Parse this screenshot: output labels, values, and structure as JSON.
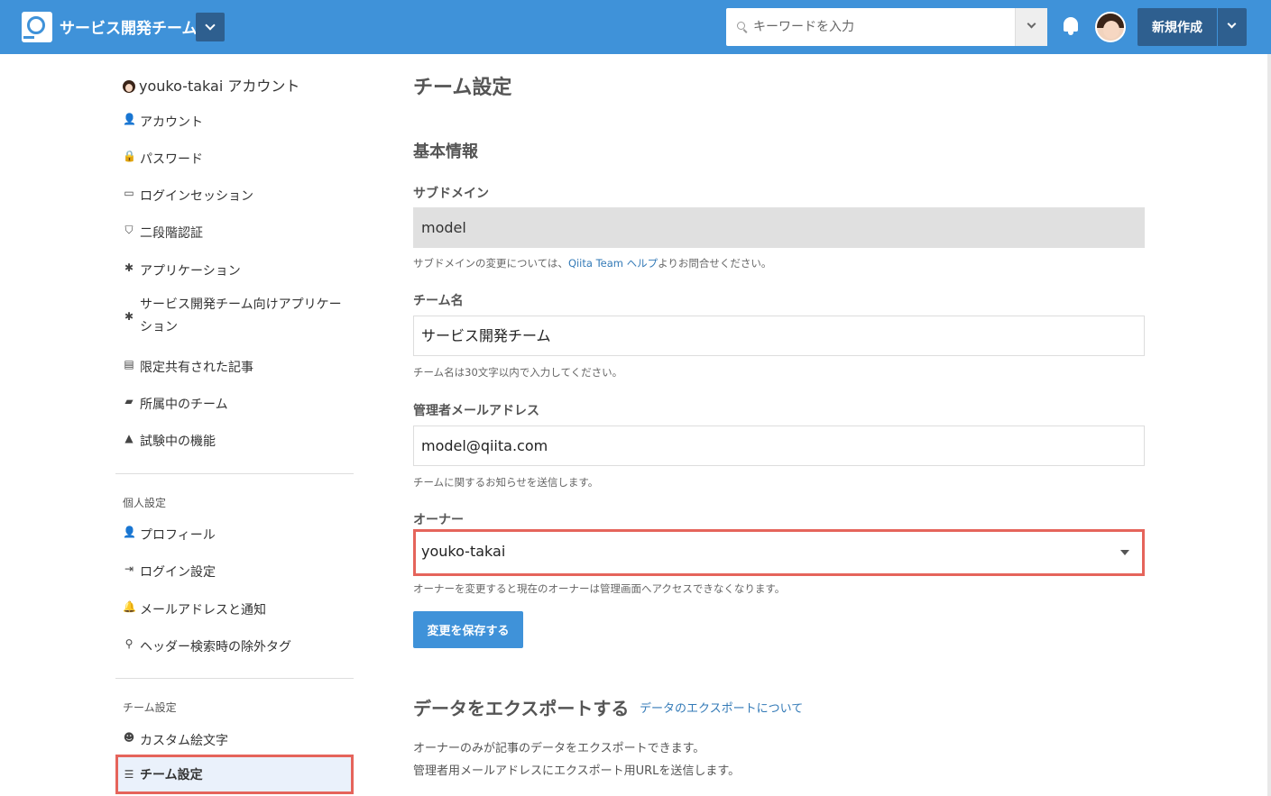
{
  "header": {
    "team_name": "サービス開発チーム",
    "search_placeholder": "キーワードを入力",
    "new_button": "新規作成"
  },
  "colors": {
    "header": "#3f92d9",
    "dark": "#2e5f8f",
    "highlight": "#e5645b",
    "link": "#337ab7"
  },
  "sidebar": {
    "account_title": "youko-takai アカウント",
    "items": [
      {
        "icon": "user-icon",
        "label": "アカウント"
      },
      {
        "icon": "lock-icon",
        "label": "パスワード"
      },
      {
        "icon": "devices-icon",
        "label": "ログインセッション"
      },
      {
        "icon": "shield-icon",
        "label": "二段階認証"
      },
      {
        "icon": "puzzle-icon",
        "label": "アプリケーション"
      },
      {
        "icon": "puzzle-icon",
        "label": "サービス開発チーム向けアプリケーション"
      },
      {
        "icon": "document-icon",
        "label": "限定共有された記事"
      },
      {
        "icon": "team-icon",
        "label": "所属中のチーム"
      },
      {
        "icon": "flask-icon",
        "label": "試験中の機能"
      }
    ],
    "personal_section": "個人設定",
    "personal_items": [
      {
        "icon": "user-icon",
        "label": "プロフィール"
      },
      {
        "icon": "login-icon",
        "label": "ログイン設定"
      },
      {
        "icon": "bell-icon",
        "label": "メールアドレスと通知"
      },
      {
        "icon": "search-tag-icon",
        "label": "ヘッダー検索時の除外タグ"
      }
    ],
    "team_section": "チーム設定",
    "team_items": [
      {
        "icon": "smile-icon",
        "label": "カスタム絵文字"
      },
      {
        "icon": "sliders-icon",
        "label": "チーム設定"
      }
    ]
  },
  "main": {
    "title": "チーム設定",
    "basic_heading": "基本情報",
    "subdomain_label": "サブドメイン",
    "subdomain_value": "model",
    "subdomain_hint_pre": "サブドメインの変更については、",
    "subdomain_hint_link": "Qiita Team ヘルプ",
    "subdomain_hint_post": "よりお問合せください。",
    "team_name_label": "チーム名",
    "team_name_value": "サービス開発チーム",
    "team_name_hint": "チーム名は30文字以内で入力してください。",
    "email_label": "管理者メールアドレス",
    "email_value": "model@qiita.com",
    "email_hint": "チームに関するお知らせを送信します。",
    "owner_label": "オーナー",
    "owner_value": "youko-takai",
    "owner_hint": "オーナーを変更すると現在のオーナーは管理画面へアクセスできなくなります。",
    "save_button": "変更を保存する",
    "export_heading": "データをエクスポートする",
    "export_link": "データのエクスポートについて",
    "export_p1": "オーナーのみが記事のデータをエクスポートできます。",
    "export_p2": "管理者用メールアドレスにエクスポート用URLを送信します。"
  }
}
